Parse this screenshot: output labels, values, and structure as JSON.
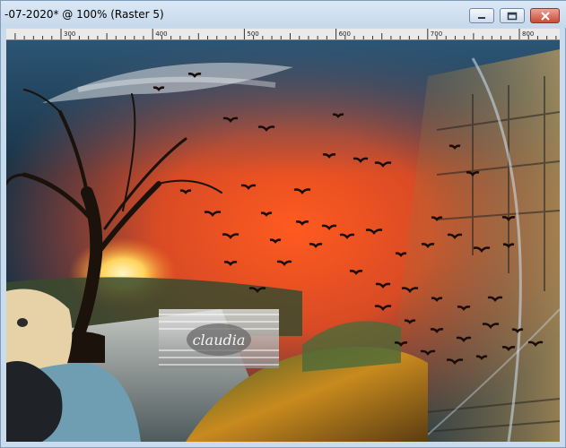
{
  "window": {
    "title": "-07-2020* @ 100% (Raster 5)",
    "controls": {
      "minimize": "minimize-icon",
      "maximize": "maximize-icon",
      "close": "close-icon"
    }
  },
  "ruler": {
    "labels": [
      "300",
      "400",
      "500",
      "600",
      "700",
      "800"
    ]
  },
  "canvas": {
    "watermark_text": "claudia",
    "colors": {
      "sky_dark": "#173246",
      "sunset": "#e8542a",
      "sun": "#ffd35c",
      "grass": "#c88a1e"
    }
  }
}
